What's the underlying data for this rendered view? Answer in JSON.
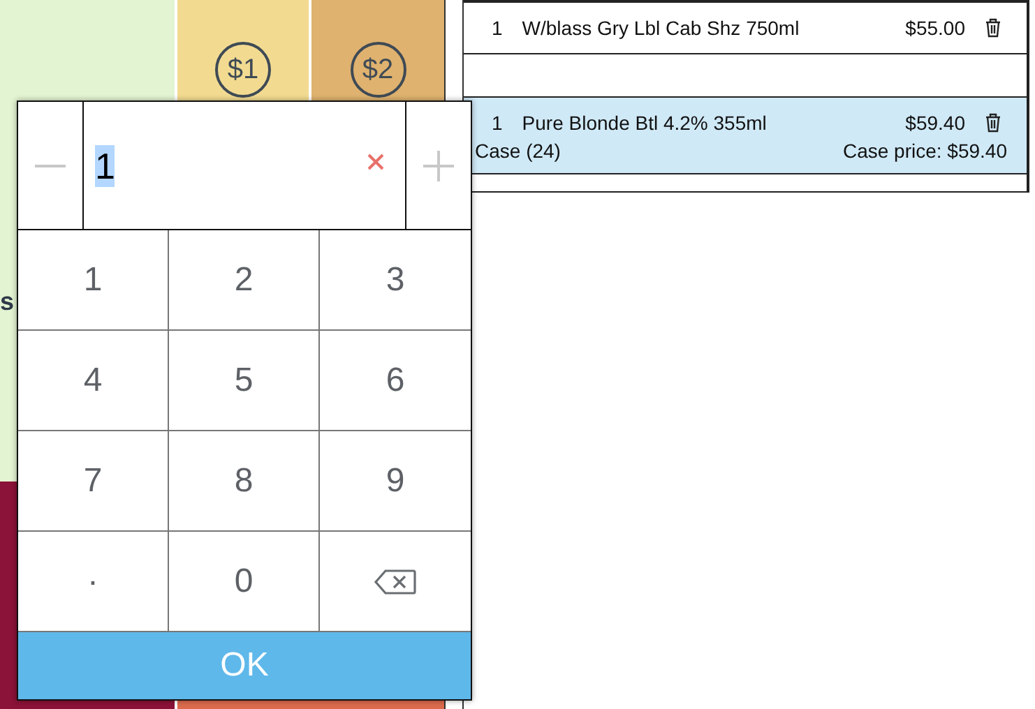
{
  "tiles": {
    "coin_1": "$1",
    "coin_2": "$2",
    "partial_label": "s"
  },
  "order_lines": [
    {
      "qty": "1",
      "name": "W/blass Gry Lbl Cab Shz 750ml",
      "price": "$55.00",
      "selected": false
    },
    {
      "qty": "1",
      "name": "Pure Blonde Btl 4.2% 355ml",
      "price": "$59.40",
      "selected": true,
      "pack": "Case (24)",
      "pack_price": "Case price: $59.40"
    }
  ],
  "keypad": {
    "value": "1",
    "keys": [
      {
        "kind": "digit",
        "label": "1"
      },
      {
        "kind": "digit",
        "label": "2"
      },
      {
        "kind": "digit",
        "label": "3"
      },
      {
        "kind": "digit",
        "label": "4"
      },
      {
        "kind": "digit",
        "label": "5"
      },
      {
        "kind": "digit",
        "label": "6"
      },
      {
        "kind": "digit",
        "label": "7"
      },
      {
        "kind": "digit",
        "label": "8"
      },
      {
        "kind": "digit",
        "label": "9"
      },
      {
        "kind": "decimal",
        "label": "."
      },
      {
        "kind": "digit",
        "label": "0"
      },
      {
        "kind": "backspace"
      }
    ],
    "ok": "OK"
  }
}
